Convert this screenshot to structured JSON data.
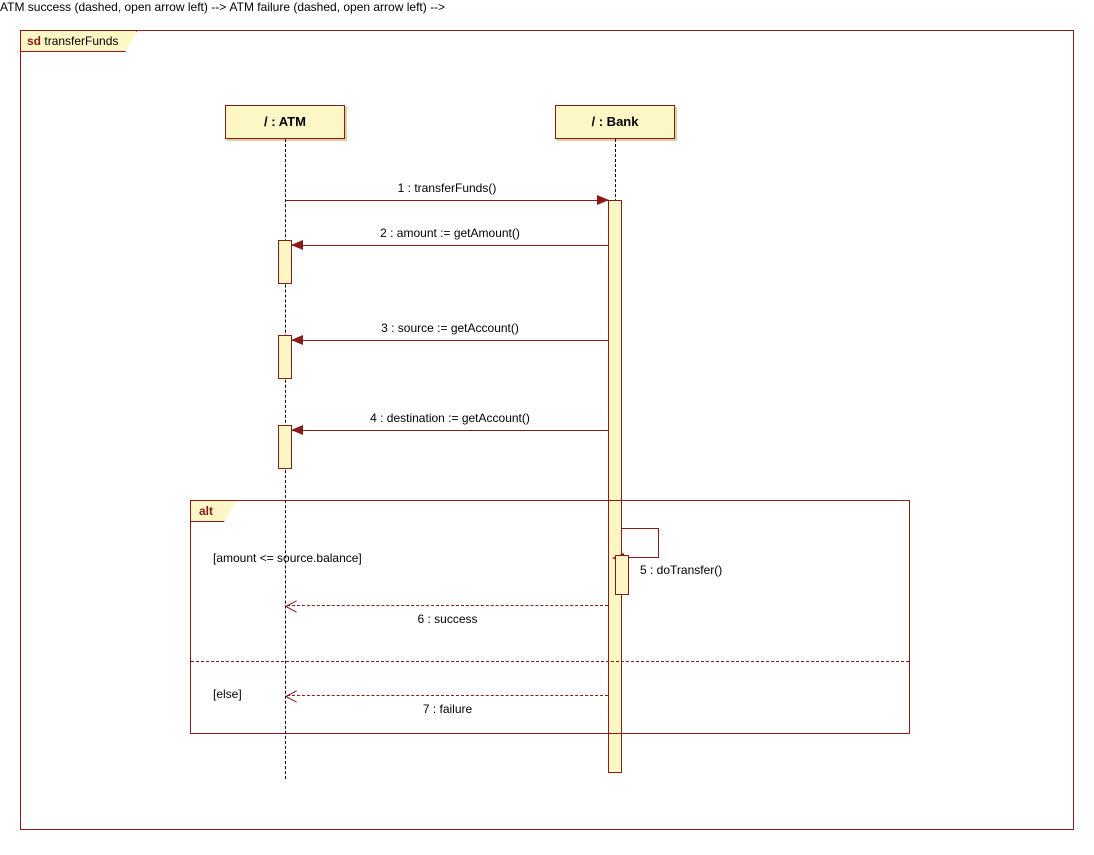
{
  "frame": {
    "keyword": "sd",
    "name": "transferFunds"
  },
  "lifelines": {
    "atm": {
      "label": "/ : ATM"
    },
    "bank": {
      "label": "/ : Bank"
    }
  },
  "messages": {
    "m1": "1 : transferFunds()",
    "m2": "2 : amount := getAmount()",
    "m3": "3 : source := getAccount()",
    "m4": "4 : destination := getAccount()",
    "m5": "5 : doTransfer()",
    "m6": "6 : success",
    "m7": "7 : failure"
  },
  "alt": {
    "keyword": "alt",
    "guard1": "[amount <= source.balance]",
    "guard2": "[else]"
  }
}
